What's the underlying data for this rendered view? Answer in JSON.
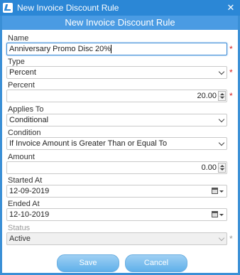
{
  "window": {
    "title": "New Invoice Discount Rule"
  },
  "header": {
    "title": "New Invoice Discount Rule"
  },
  "form": {
    "name": {
      "label": "Name",
      "value": "Anniversary Promo Disc 20%",
      "required": "*"
    },
    "type": {
      "label": "Type",
      "value": "Percent",
      "required": "*"
    },
    "percent": {
      "label": "Percent",
      "value": "20.00",
      "required": "*"
    },
    "applies_to": {
      "label": "Applies To",
      "value": "Conditional"
    },
    "condition": {
      "label": "Condition",
      "value": "If Invoice Amount is Greater Than or Equal To"
    },
    "amount": {
      "label": "Amount",
      "value": "0.00"
    },
    "started_at": {
      "label": "Started At",
      "value": "12-09-2019"
    },
    "ended_at": {
      "label": "Ended At",
      "value": "12-10-2019"
    },
    "status": {
      "label": "Status",
      "value": "Active",
      "required": "*"
    }
  },
  "buttons": {
    "save": "Save",
    "cancel": "Cancel"
  },
  "colors": {
    "titlebar": "#2b87d6",
    "header": "#4a9be3",
    "required": "#d51a1a",
    "button": "#5fb0ea"
  },
  "icons": {
    "app": "app-logo-icon",
    "close": "close-icon"
  }
}
